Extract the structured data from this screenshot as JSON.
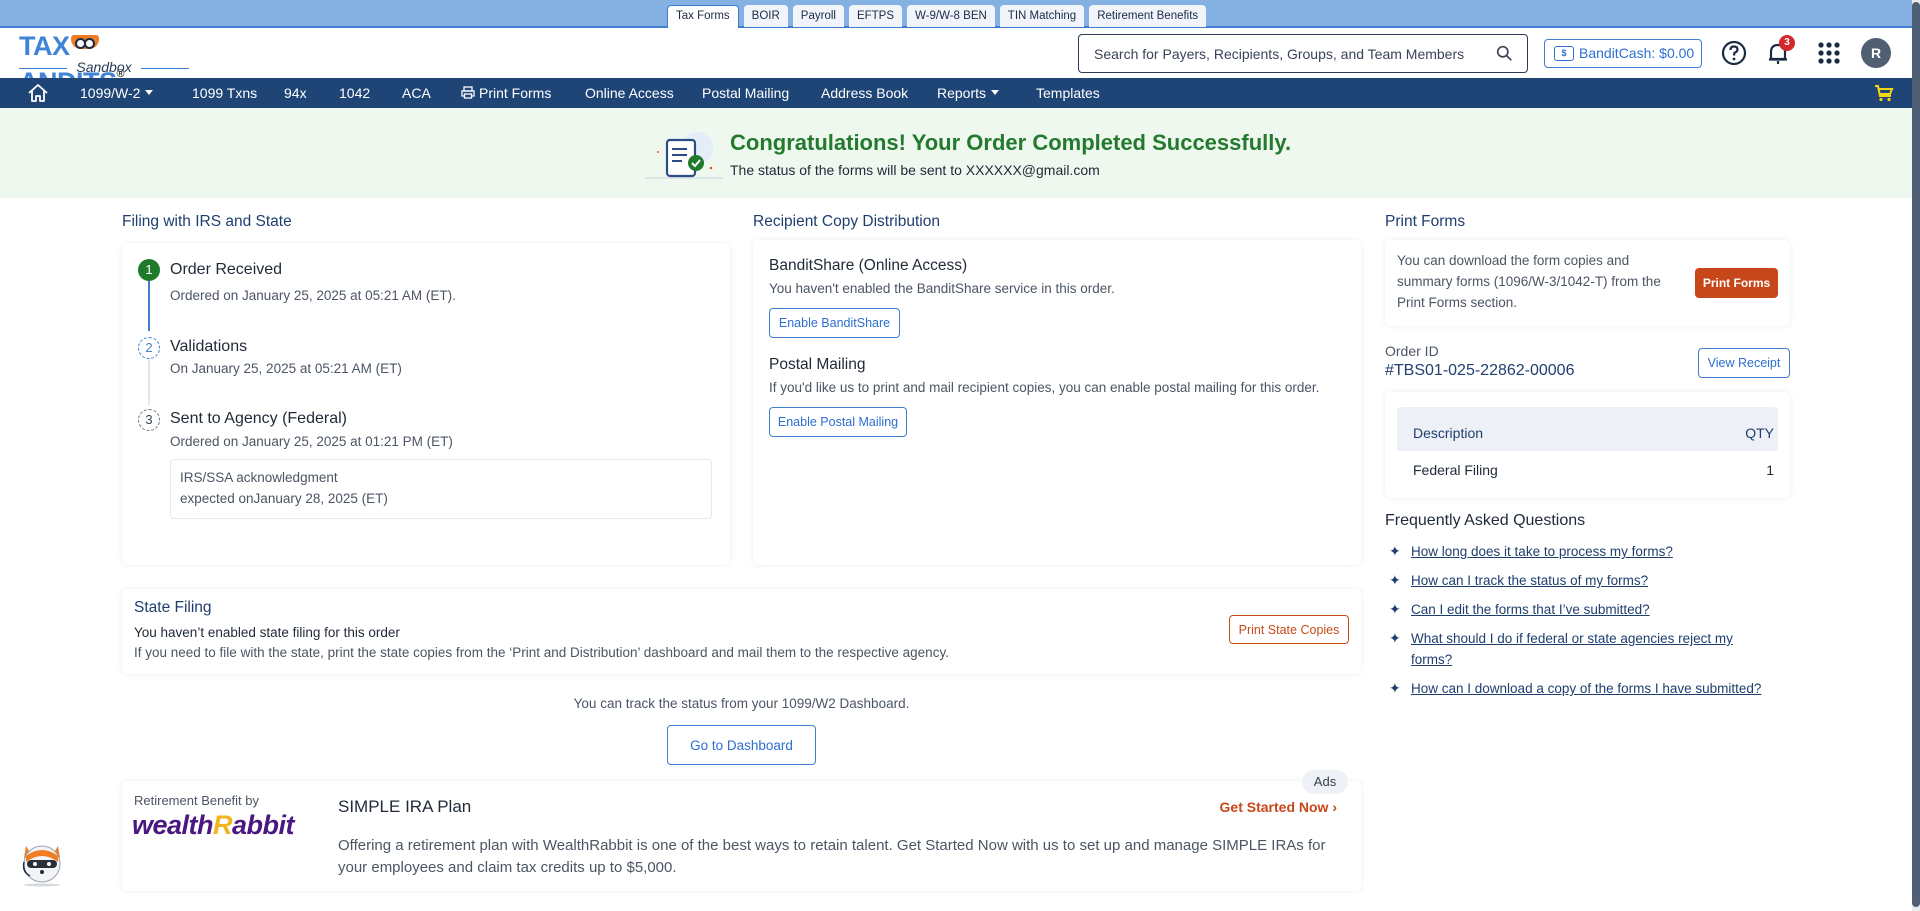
{
  "product_tabs": [
    {
      "label": "Tax Forms",
      "active": true
    },
    {
      "label": "BOIR"
    },
    {
      "label": "Payroll"
    },
    {
      "label": "EFTPS"
    },
    {
      "label": "W-9/W-8 BEN"
    },
    {
      "label": "TIN Matching"
    },
    {
      "label": "Retirement Benefits"
    }
  ],
  "header": {
    "logo_text_left": "TAX",
    "logo_text_right": "ANDITS",
    "logo_reg": "®",
    "logo_sub": "Sandbox",
    "search_placeholder": "Search for Payers, Recipients, Groups, and Team Members",
    "search_value": "",
    "bandit_cash_label": "BanditCash: $0.00",
    "notification_count": "3",
    "avatar_initial": "R"
  },
  "nav": {
    "items": [
      {
        "label": "1099/W-2",
        "dropdown": true
      },
      {
        "label": "1099 Txns"
      },
      {
        "label": "94x"
      },
      {
        "label": "1042"
      },
      {
        "label": "ACA"
      },
      {
        "label": "Print Forms",
        "icon": "printer-icon"
      },
      {
        "label": "Online Access"
      },
      {
        "label": "Postal Mailing"
      },
      {
        "label": "Address Book"
      },
      {
        "label": "Reports",
        "dropdown": true
      },
      {
        "label": "Templates"
      }
    ]
  },
  "banner": {
    "title": "Congratulations! Your Order Completed Successfully.",
    "subtitle": "The status of the forms will be sent to XXXXXX@gmail.com",
    "color": "#237a2e"
  },
  "filing": {
    "title": "Filing with IRS and State",
    "steps": [
      {
        "num": "1",
        "title": "Order Received",
        "sub": "Ordered on January 25, 2025 at 05:21 AM (ET).",
        "status": "done"
      },
      {
        "num": "2",
        "title": "Validations",
        "sub": "On January 25, 2025 at 05:21 AM (ET)",
        "status": "current"
      },
      {
        "num": "3",
        "title": "Sent to Agency (Federal)",
        "sub": "Ordered on January 25, 2025 at 01:21 PM (ET)",
        "status": "pending"
      }
    ],
    "ack_line1": "IRS/SSA acknowledgment",
    "ack_line2": "expected onJanuary 28, 2025 (ET)"
  },
  "recipient": {
    "title": "Recipient Copy Distribution",
    "banditshare_title": "BanditShare (Online Access)",
    "banditshare_text": "You haven't enabled the BanditShare service in this order.",
    "banditshare_button": "Enable BanditShare",
    "postal_title": "Postal Mailing",
    "postal_text": "If you'd like us to print and mail recipient copies, you can enable postal mailing for this order.",
    "postal_button": "Enable Postal Mailing"
  },
  "print_forms": {
    "title": "Print Forms",
    "text_line1": "You can download the form copies and",
    "text_line2": "summary forms (1096/W-3/1042-T) from the",
    "text_line3": "Print Forms section.",
    "button": "Print Forms"
  },
  "order": {
    "id_label": "Order ID",
    "id_value": "#TBS01-025-22862-00006",
    "view_receipt": "View Receipt",
    "table": {
      "headers": [
        "Description",
        "QTY"
      ],
      "rows": [
        [
          "Federal Filing",
          "1"
        ]
      ]
    }
  },
  "faq": {
    "title": "Frequently Asked Questions",
    "items": [
      "How long does it take to process my forms?",
      "How can I track the status of my forms?",
      "Can I edit the forms that I’ve submitted?",
      "What should I do if federal or state agencies reject my",
      "forms?",
      "How can I download a copy of the forms I have submitted?"
    ]
  },
  "state_filing": {
    "title": "State Filing",
    "line1": "You haven’t enabled state filing for this order",
    "line2": "If you need to file with the state, print the state copies from the ‘Print and Distribution’ dashboard and mail them to the respective agency.",
    "button": "Print State Copies"
  },
  "track": {
    "text": "You can track the status from your 1099/W2 Dashboard.",
    "button": "Go to Dashboard"
  },
  "ad": {
    "label": "Retirement Benefit by",
    "brand_left": "wealth",
    "brand_r": "R",
    "brand_right": "abbit",
    "title": "SIMPLE IRA Plan",
    "body": "Offering a retirement plan with WealthRabbit is one of the best ways to retain talent. Get Started Now with us to set up and manage SIMPLE IRAs for your employees and claim tax credits up to $5,000.",
    "cta": "Get Started Now ›",
    "pill": "Ads"
  }
}
